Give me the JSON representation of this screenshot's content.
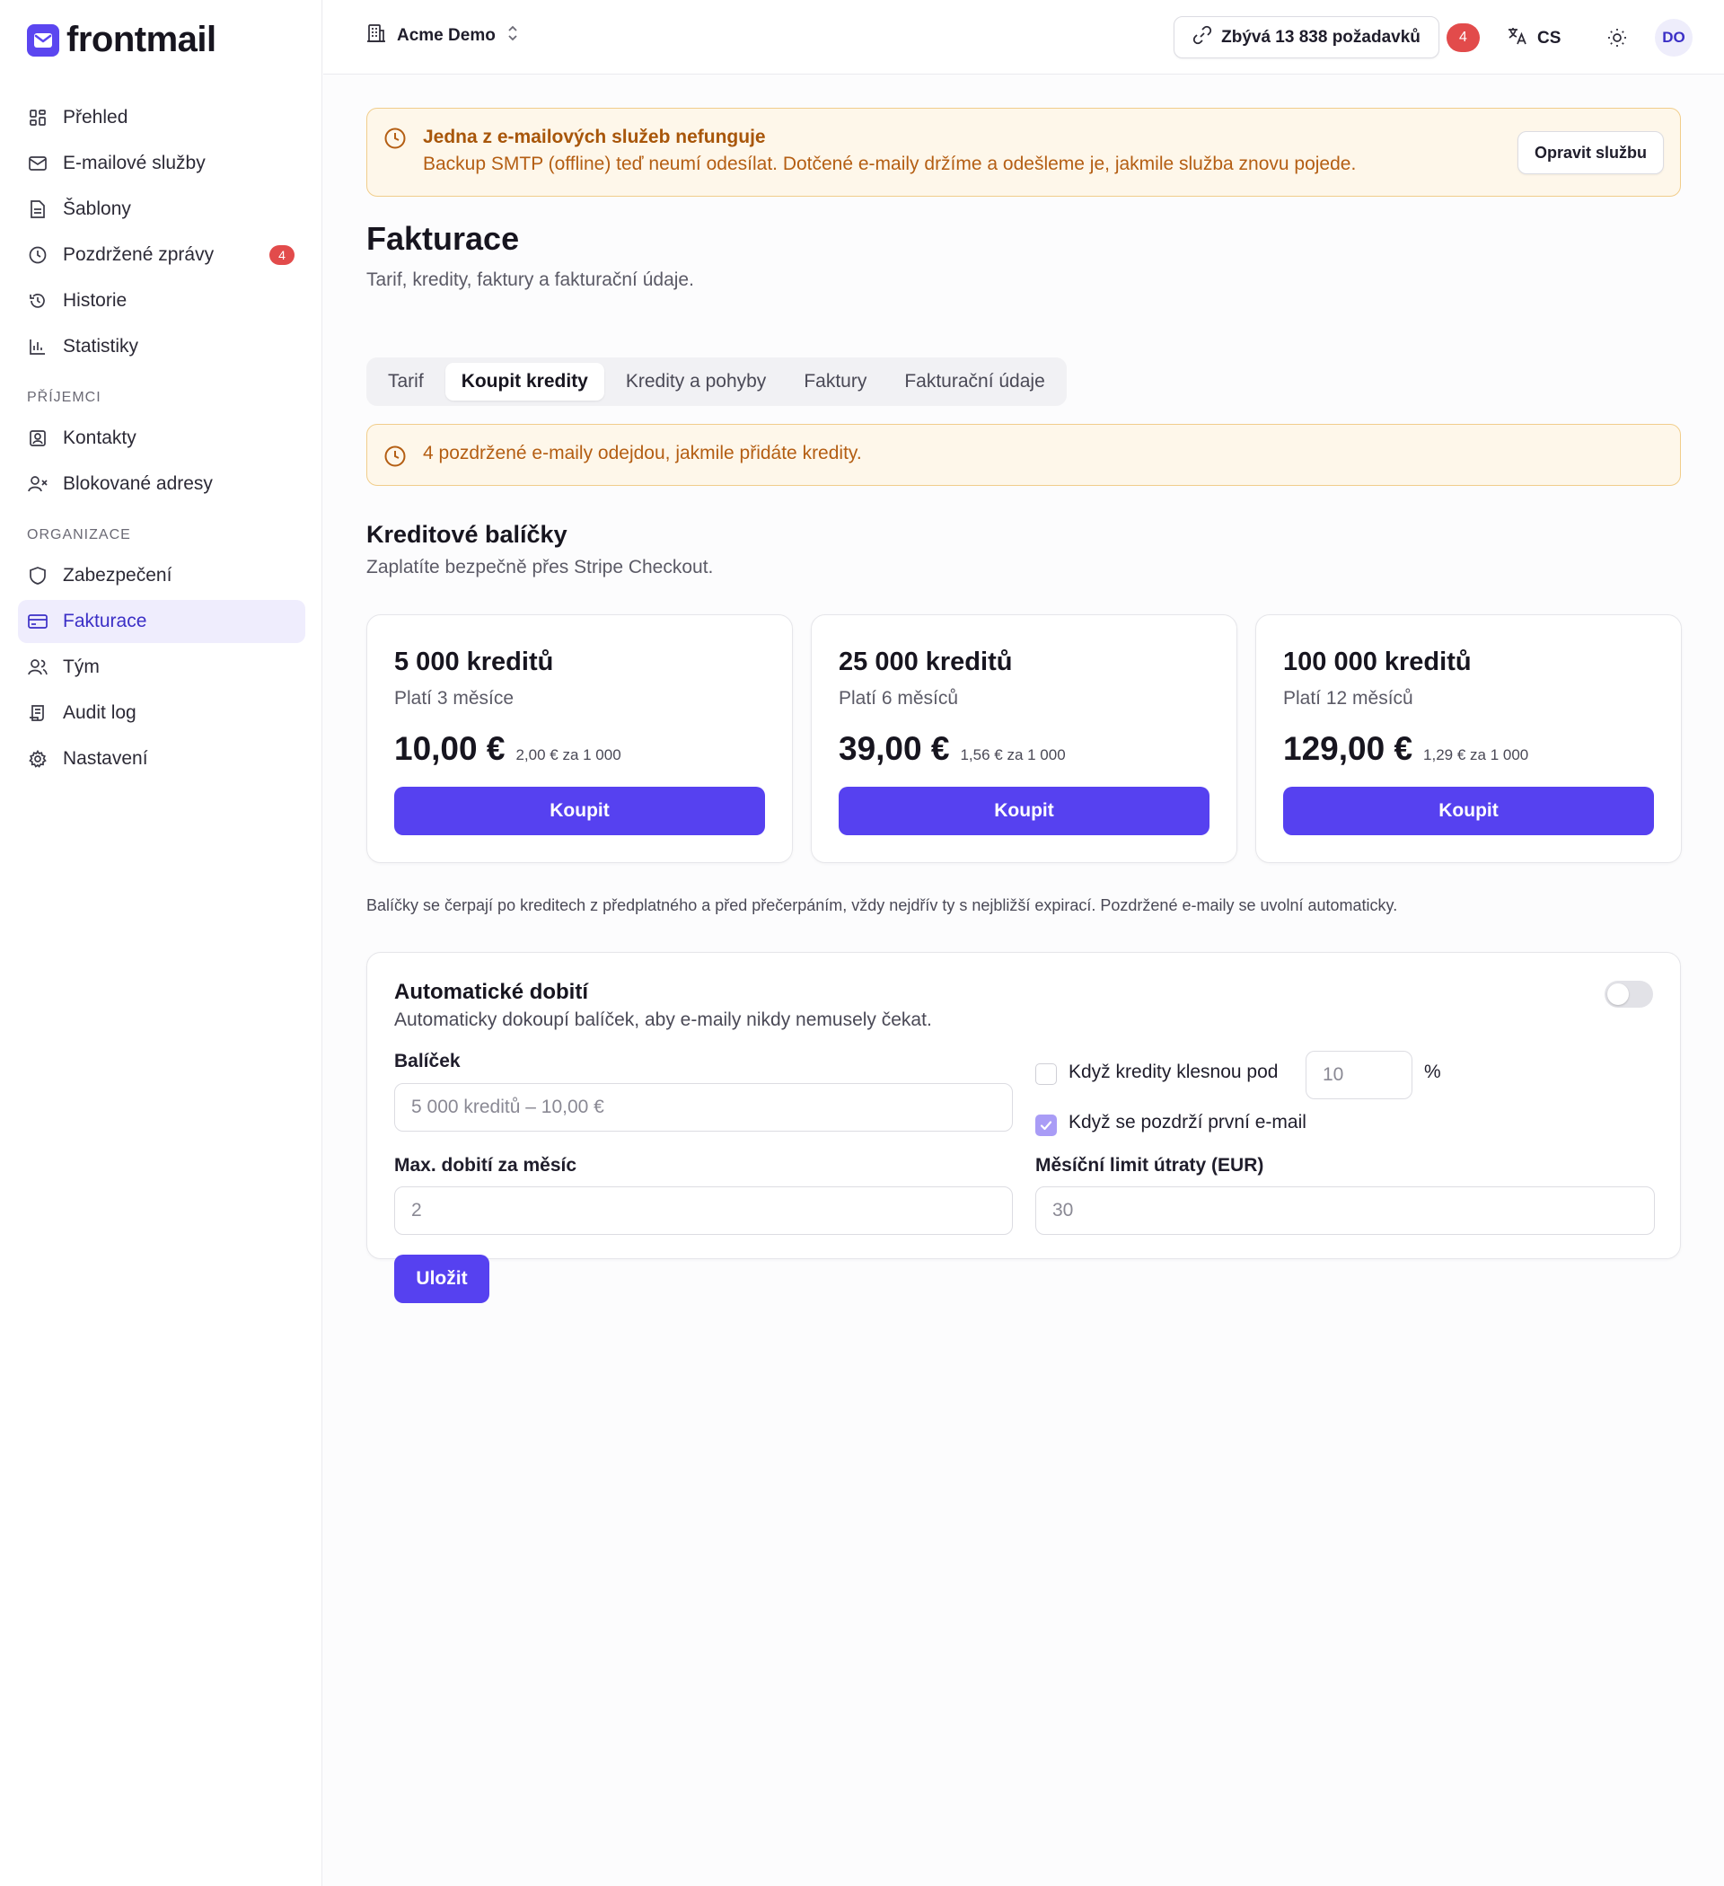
{
  "app": {
    "name": "frontmail"
  },
  "sidebar": {
    "items": [
      {
        "label": "Přehled",
        "icon": "dashboard-icon"
      },
      {
        "label": "E-mailové služby",
        "icon": "mail-icon"
      },
      {
        "label": "Šablony",
        "icon": "document-icon"
      },
      {
        "label": "Pozdržené zprávy",
        "icon": "clock-icon",
        "badge": "4"
      },
      {
        "label": "Historie",
        "icon": "history-icon"
      },
      {
        "label": "Statistiky",
        "icon": "bar-chart-icon"
      }
    ],
    "section_recipients": "PŘÍJEMCI",
    "recipients": [
      {
        "label": "Kontakty",
        "icon": "contact-icon"
      },
      {
        "label": "Blokované adresy",
        "icon": "user-blocked-icon"
      }
    ],
    "section_org": "ORGANIZACE",
    "org": [
      {
        "label": "Zabezpečení",
        "icon": "shield-icon"
      },
      {
        "label": "Fakturace",
        "icon": "credit-card-icon",
        "active": true
      },
      {
        "label": "Tým",
        "icon": "users-icon"
      },
      {
        "label": "Audit log",
        "icon": "audit-icon"
      },
      {
        "label": "Nastavení",
        "icon": "gear-icon"
      }
    ]
  },
  "topbar": {
    "org_name": "Acme Demo",
    "requests_label": "Zbývá 13 838 požadavků",
    "notification_count": "4",
    "language": "CS",
    "avatar_initials": "DO"
  },
  "alert": {
    "title": "Jedna z e-mailových služeb nefunguje",
    "text": "Backup SMTP (offline) teď neumí odesílat. Dotčené e-maily držíme a odešleme je, jakmile služba znovu pojede.",
    "button": "Opravit službu"
  },
  "page": {
    "title": "Fakturace",
    "subtitle": "Tarif, kredity, faktury a fakturační údaje."
  },
  "tabs": [
    {
      "label": "Tarif",
      "active": false
    },
    {
      "label": "Koupit kredity",
      "active": true
    },
    {
      "label": "Kredity a pohyby",
      "active": false
    },
    {
      "label": "Faktury",
      "active": false
    },
    {
      "label": "Fakturační údaje",
      "active": false
    }
  ],
  "held_alert": {
    "text": "4 pozdržené e-maily odejdou, jakmile přidáte kredity."
  },
  "packages": {
    "title": "Kreditové balíčky",
    "subtitle": "Zaplatíte bezpečně přes Stripe Checkout.",
    "items": [
      {
        "title": "5 000 kreditů",
        "validity": "Platí 3 měsíce",
        "price": "10,00 €",
        "unit_price": "2,00 € za 1 000",
        "button": "Koupit"
      },
      {
        "title": "25 000 kreditů",
        "validity": "Platí 6 měsíců",
        "price": "39,00 €",
        "unit_price": "1,56 € za 1 000",
        "button": "Koupit"
      },
      {
        "title": "100 000 kreditů",
        "validity": "Platí 12 měsíců",
        "price": "129,00 €",
        "unit_price": "1,29 € za 1 000",
        "button": "Koupit"
      }
    ],
    "note": "Balíčky se čerpají po kreditech z předplatného a před přečerpáním, vždy nejdřív ty s nejbližší expirací. Pozdržené e-maily se uvolní automaticky."
  },
  "auto_topup": {
    "title": "Automatické dobití",
    "subtitle": "Automaticky dokoupí balíček, aby e-maily nikdy nemusely čekat.",
    "enabled": false,
    "package_label": "Balíček",
    "package_value": "5 000 kreditů – 10,00 €",
    "threshold_label": "Když kredity klesnou pod",
    "threshold_checked": false,
    "threshold_placeholder": "10",
    "threshold_unit": "%",
    "first_held_label": "Když se pozdrží první e-mail",
    "first_held_checked": true,
    "max_label": "Max. dobití za měsíc",
    "max_placeholder": "2",
    "limit_label": "Měsíční limit útraty (EUR)",
    "limit_placeholder": "30",
    "save_button": "Uložit"
  },
  "colors": {
    "accent": "#5641f0",
    "warning_bg": "#fef7ea",
    "warning_border": "#f1cd8b",
    "warning_text": "#a8560a",
    "badge": "#e24b4b"
  }
}
